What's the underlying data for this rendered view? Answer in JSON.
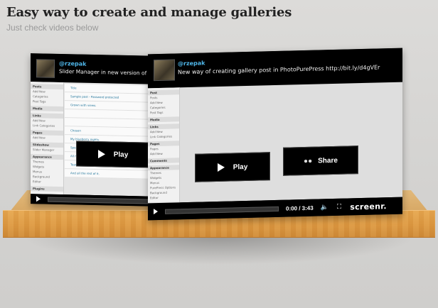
{
  "header": {
    "title": "Easy way to create and manage galleries",
    "subtitle": "Just check videos below"
  },
  "video1": {
    "handle": "@rzepak",
    "tweet": "Slider Manager in new version of Photo...",
    "play_label": "Play",
    "sidebar": [
      "Posts",
      "Add New",
      "Categories",
      "Post Tags",
      "Media",
      "Links",
      "Add New",
      "Link Categories",
      "Pages",
      "Add New",
      "Slideshow",
      "Slider Manager",
      "Appearance",
      "Themes",
      "Widgets",
      "Menus",
      "Background",
      "Editor",
      "Plugins"
    ],
    "rows": [
      "Title",
      "Sample post - Password protected",
      "Grown with views.",
      "",
      "",
      "Chosen",
      "My blueberry nights.",
      "Speak up, man!",
      "All my colors.",
      "Tears Theirs.",
      "And all the rest of it."
    ]
  },
  "video2": {
    "handle": "@rzepak",
    "tweet": "New way of creating gallery post in PhotoPurePress http://bit.ly/d4gVEr",
    "play_label": "Play",
    "share_label": "Share",
    "sidebar": [
      "Post",
      "Posts",
      "Add New",
      "Categories",
      "Post Tags",
      "Media",
      "Links",
      "Add New",
      "Link Categories",
      "Pages",
      "Pages",
      "Add New",
      "Comments",
      "Appearance",
      "Themes",
      "Widgets",
      "Menus",
      "PurePress Options",
      "Background",
      "Editor",
      "Plugins"
    ],
    "time": "0:00 / 3:43",
    "brand": "screenr."
  }
}
